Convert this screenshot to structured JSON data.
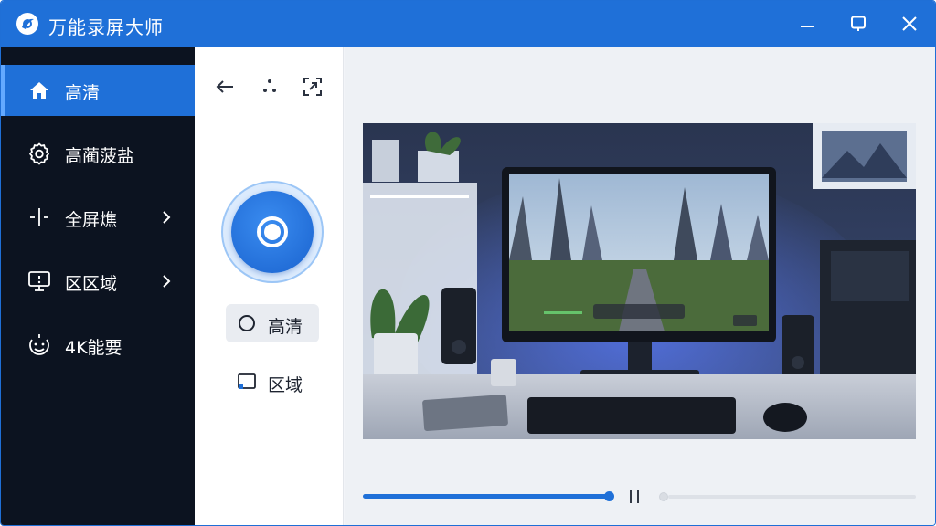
{
  "app": {
    "title": "万能录屏大师",
    "accent_color": "#1f70d8",
    "logo_icon": "app-logo-icon"
  },
  "window_controls": {
    "minimize_icon": "minimize-icon",
    "maximize_icon": "maximize-icon",
    "close_icon": "close-icon"
  },
  "sidebar": {
    "items": [
      {
        "label": "高清",
        "icon": "home-icon",
        "active": true,
        "has_submenu": false
      },
      {
        "label": "高蔺菠盐",
        "icon": "gear-icon",
        "active": false,
        "has_submenu": false
      },
      {
        "label": "全屏燋",
        "icon": "crosshair-icon",
        "active": false,
        "has_submenu": true
      },
      {
        "label": "区区域",
        "icon": "monitor-icon",
        "active": false,
        "has_submenu": true
      },
      {
        "label": "4K能要",
        "icon": "face-icon",
        "active": false,
        "has_submenu": false
      }
    ]
  },
  "toolbar": {
    "back_icon": "arrow-left-icon",
    "more_icon": "dots-icon",
    "region_icon": "region-select-icon"
  },
  "record": {
    "icon": "record-icon"
  },
  "modes": [
    {
      "label": "高清",
      "icon": "circle-icon",
      "active": true
    },
    {
      "label": "区域",
      "icon": "window-region-icon",
      "active": false
    }
  ],
  "preview": {
    "description_icon": "preview-image"
  },
  "playback": {
    "progress": 0.45,
    "volume": 0.0,
    "pause_icon": "pause-icon"
  }
}
